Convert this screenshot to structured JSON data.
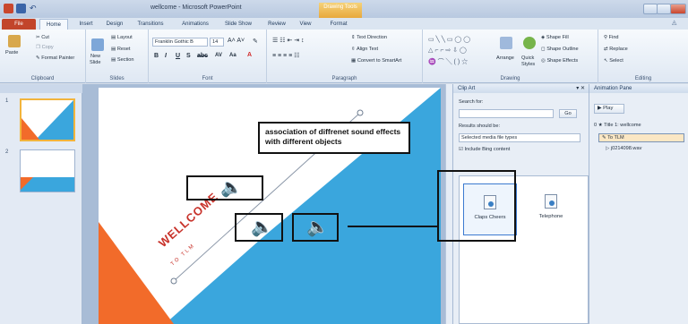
{
  "window": {
    "title": "wellcome - Microsoft PowerPoint",
    "context_tab_group": "Drawing Tools"
  },
  "tabs": [
    "File",
    "Home",
    "Insert",
    "Design",
    "Transitions",
    "Animations",
    "Slide Show",
    "Review",
    "View",
    "Format"
  ],
  "ribbon": {
    "clipboard": {
      "label": "Clipboard",
      "paste": "Paste",
      "cut": "Cut",
      "copy": "Copy",
      "format_painter": "Format Painter"
    },
    "slides": {
      "label": "Slides",
      "new_slide": "New",
      "new_slide_line2": "Slide",
      "layout": "Layout",
      "reset": "Reset",
      "section": "Section"
    },
    "font": {
      "label": "Font",
      "font_name": "Franklin Gothic B",
      "font_size": "14"
    },
    "paragraph": {
      "label": "Paragraph",
      "text_direction": "Text Direction",
      "align_text": "Align Text",
      "convert_smartart": "Convert to SmartArt"
    },
    "drawing": {
      "label": "Drawing",
      "arrange": "Arrange",
      "quick_styles": "Quick",
      "quick_styles_line2": "Styles",
      "shape_fill": "Shape Fill",
      "shape_outline": "Shape Outline",
      "shape_effects": "Shape Effects"
    },
    "editing": {
      "label": "Editing",
      "find": "Find",
      "replace": "Replace",
      "select": "Select"
    }
  },
  "slides_panel": {
    "thumbnails": [
      "1",
      "2"
    ]
  },
  "slide": {
    "callout_text": "association of diffrenet sound effects with different objects",
    "title": "WELLCOME",
    "subtitle": "TO TLM"
  },
  "clip_art": {
    "header": "Clip Art",
    "search_for_label": "Search for:",
    "search_value": "",
    "go": "Go",
    "results_label": "Results should be:",
    "results_value": "Selected media file types",
    "include_bing": "Include Bing content",
    "results": [
      "Claps Cheers",
      "Telephone"
    ]
  },
  "animation_pane": {
    "header": "Animation Pane",
    "play": "Play",
    "items": [
      {
        "index": "0",
        "label": "Title 1: wellcome"
      },
      {
        "index": "",
        "label": "To TLM"
      },
      {
        "index": "",
        "label": "j0214098.wav"
      }
    ]
  },
  "colors": {
    "accent_blue": "#3aa6dd",
    "accent_orange": "#f26b2a",
    "file_tab": "#c2452b"
  }
}
